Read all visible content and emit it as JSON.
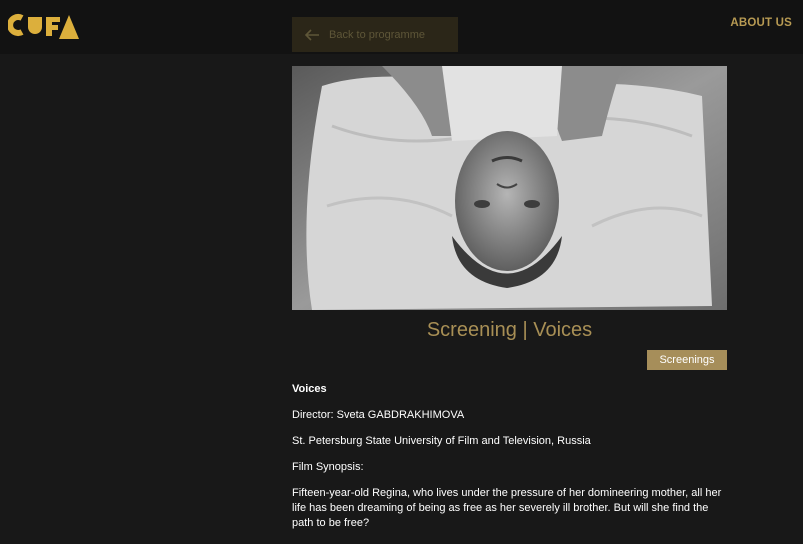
{
  "header": {
    "logo_text": "CUFA",
    "back_label": "Back to programme",
    "nav_about": "ABOUT US"
  },
  "event": {
    "title": "Screening | Voices",
    "tag": "Screenings",
    "film_title": "Voices",
    "director": "Director: Sveta GABDRAKHIMOVA",
    "institution": "St. Petersburg State University of Film and Television, Russia",
    "synopsis_label": "Film Synopsis:",
    "synopsis": "Fifteen-year-old Regina, who lives under the pressure of her domineering mother, all her life has been dreaming of being as free as her severely ill brother. But will she find the path to be free?"
  },
  "colors": {
    "accent": "#a88f55",
    "background": "#181818",
    "header_bg": "#121212"
  }
}
